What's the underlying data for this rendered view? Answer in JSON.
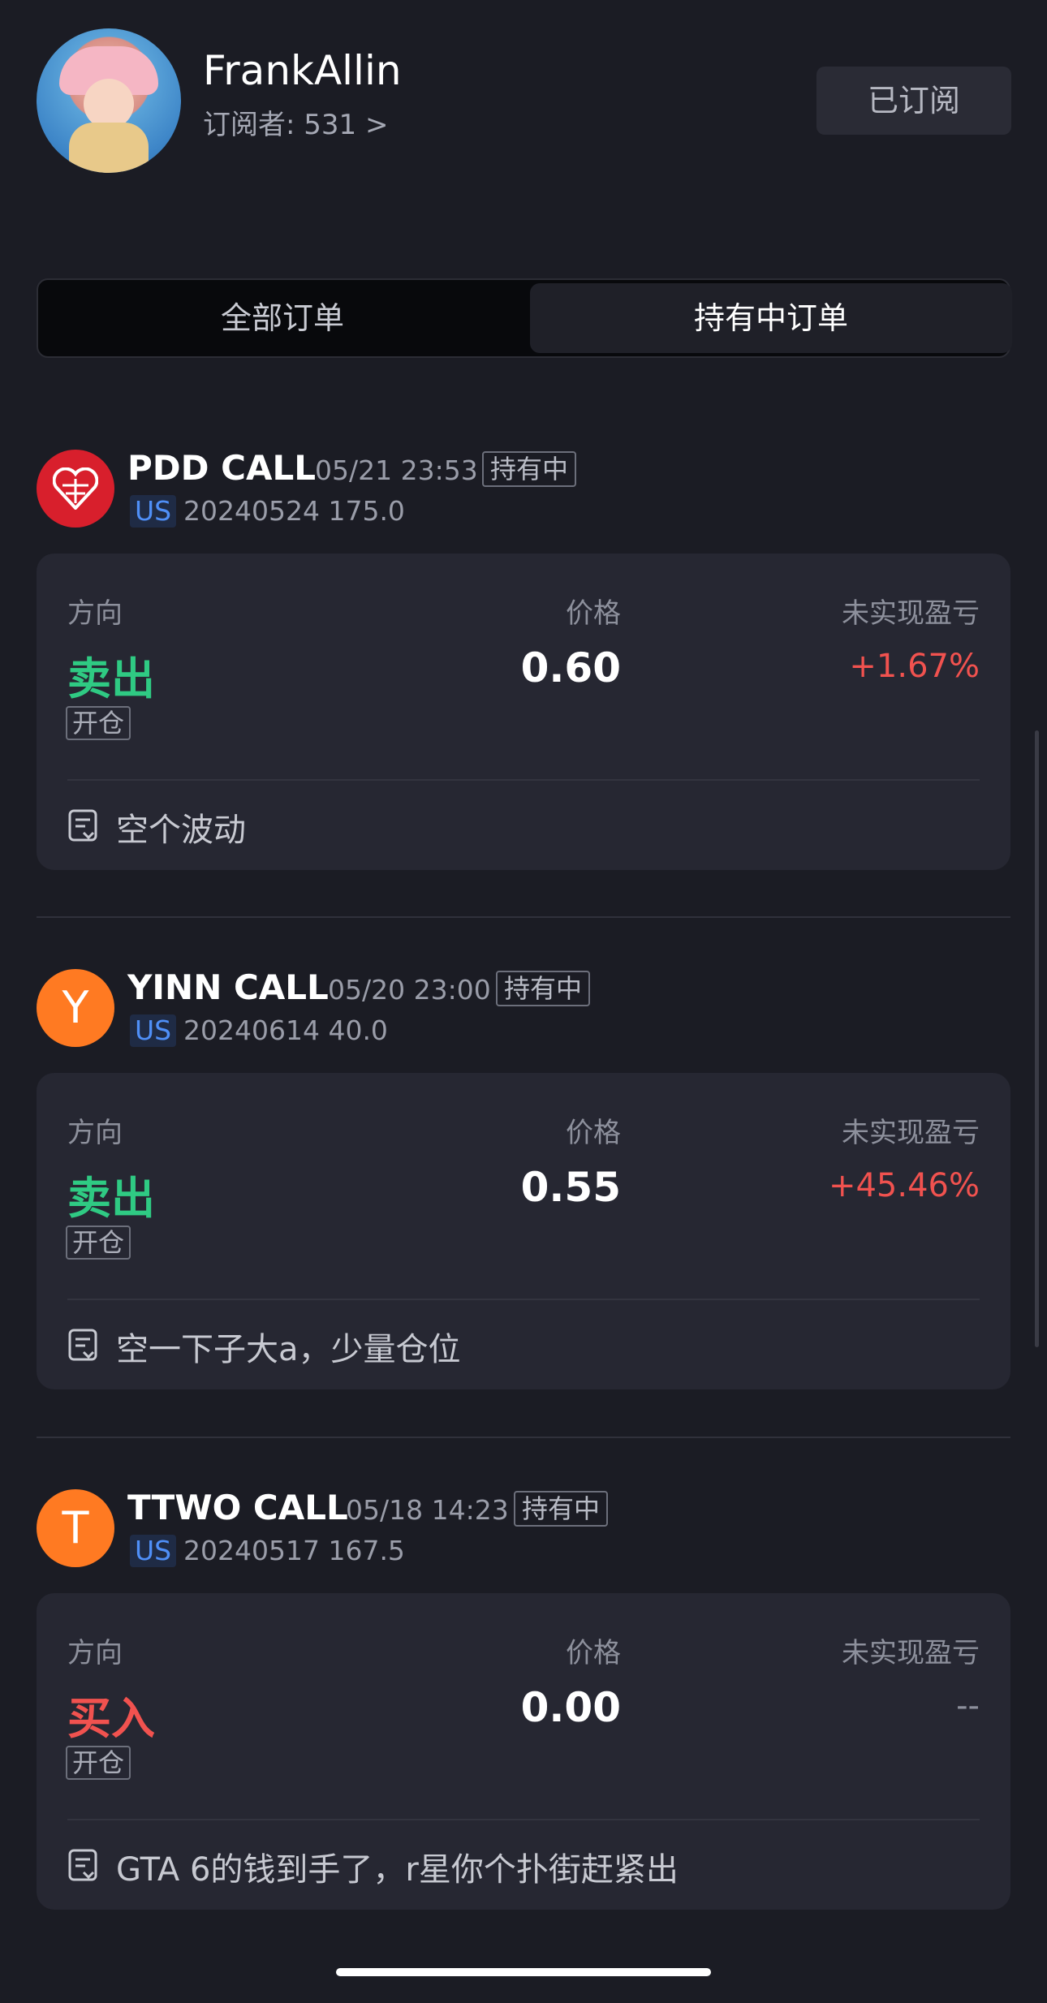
{
  "profile": {
    "name": "FrankAllin",
    "subscribers": "订阅者: 531 >",
    "subscribe_button": "已订阅"
  },
  "tabs": [
    "全部订单",
    "持有中订单"
  ],
  "active_tab": "持有中订单",
  "labels": {
    "direction": "方向",
    "price": "价格",
    "pnl": "未实现盈亏"
  },
  "orders": [
    {
      "symbol": "PDD CALL",
      "time": "05/21 23:53",
      "status": "持有中",
      "market": "US",
      "contract": "20240524 175.0",
      "logo_icon": "pinduoduo-logo-icon",
      "direction": "卖出",
      "open_label": "开仓",
      "price": "0.60",
      "pnl": "+1.67%",
      "note": "空个波动"
    },
    {
      "symbol": "YINN CALL",
      "time": "05/20 23:00",
      "status": "持有中",
      "market": "US",
      "contract": "20240614 40.0",
      "logo_letter": "Y",
      "direction": "卖出",
      "open_label": "开仓",
      "price": "0.55",
      "pnl": "+45.46%",
      "note": "空一下子大a，少量仓位"
    },
    {
      "symbol": "TTWO CALL",
      "time": "05/18 14:23",
      "status": "持有中",
      "market": "US",
      "contract": "20240517 167.5",
      "logo_letter": "T",
      "direction": "买入",
      "open_label": "开仓",
      "price": "0.00",
      "pnl": "--",
      "note": "GTA 6的钱到手了，r星你个扑街赶紧出"
    }
  ],
  "colors": {
    "sell": "#2fca83",
    "buy": "#f1524f",
    "profit": "#f1524f",
    "market_tag": "#4f8ff7"
  }
}
